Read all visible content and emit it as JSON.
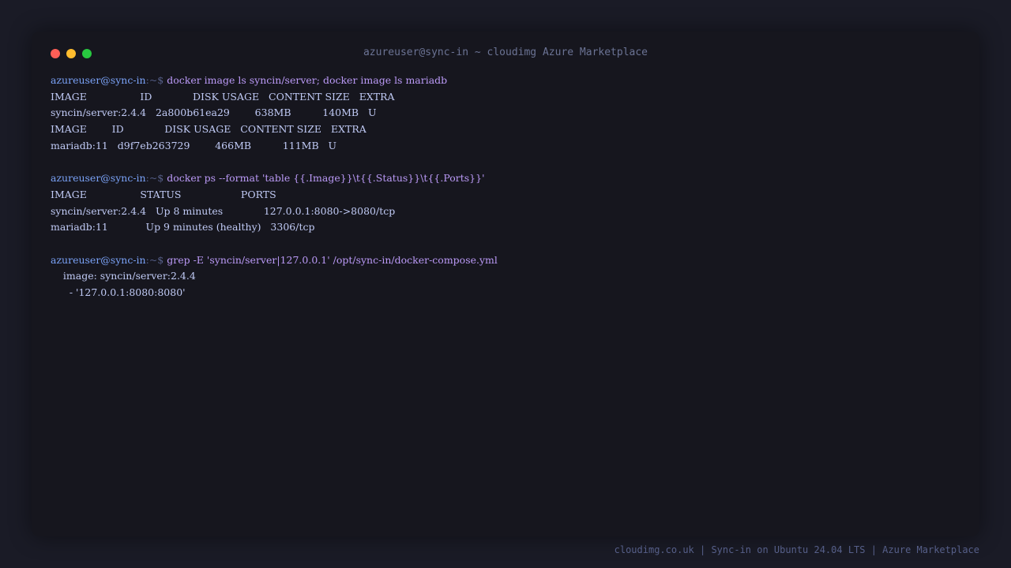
{
  "window": {
    "title": "azureuser@sync-in ~ cloudimg Azure Marketplace"
  },
  "prompt": {
    "user": "azureuser@sync-in",
    "path": ":~$ "
  },
  "blocks": [
    {
      "command": "docker image ls syncin/server; docker image ls mariadb",
      "output": [
        "IMAGE                 ID             DISK USAGE   CONTENT SIZE   EXTRA",
        "syncin/server:2.4.4   2a800b61ea29        638MB          140MB   U",
        "IMAGE        ID             DISK USAGE   CONTENT SIZE   EXTRA",
        "mariadb:11   d9f7eb263729        466MB          111MB   U"
      ]
    },
    {
      "command": "docker ps --format 'table {{.Image}}\\t{{.Status}}\\t{{.Ports}}'",
      "output": [
        "IMAGE                 STATUS                   PORTS",
        "syncin/server:2.4.4   Up 8 minutes             127.0.0.1:8080->8080/tcp",
        "mariadb:11            Up 9 minutes (healthy)   3306/tcp"
      ]
    },
    {
      "command": "grep -E 'syncin/server|127.0.0.1' /opt/sync-in/docker-compose.yml",
      "output": [
        "    image: syncin/server:2.4.4",
        "      - '127.0.0.1:8080:8080'"
      ]
    }
  ],
  "footer": "cloudimg.co.uk | Sync-in on Ubuntu 24.04 LTS | Azure Marketplace",
  "colors": {
    "background": "#1a1b26",
    "window": "#16161e",
    "prompt_user": "#7aa2f7",
    "prompt_path": "#565f89",
    "command": "#bb9af7",
    "output": "#c0caf5"
  }
}
